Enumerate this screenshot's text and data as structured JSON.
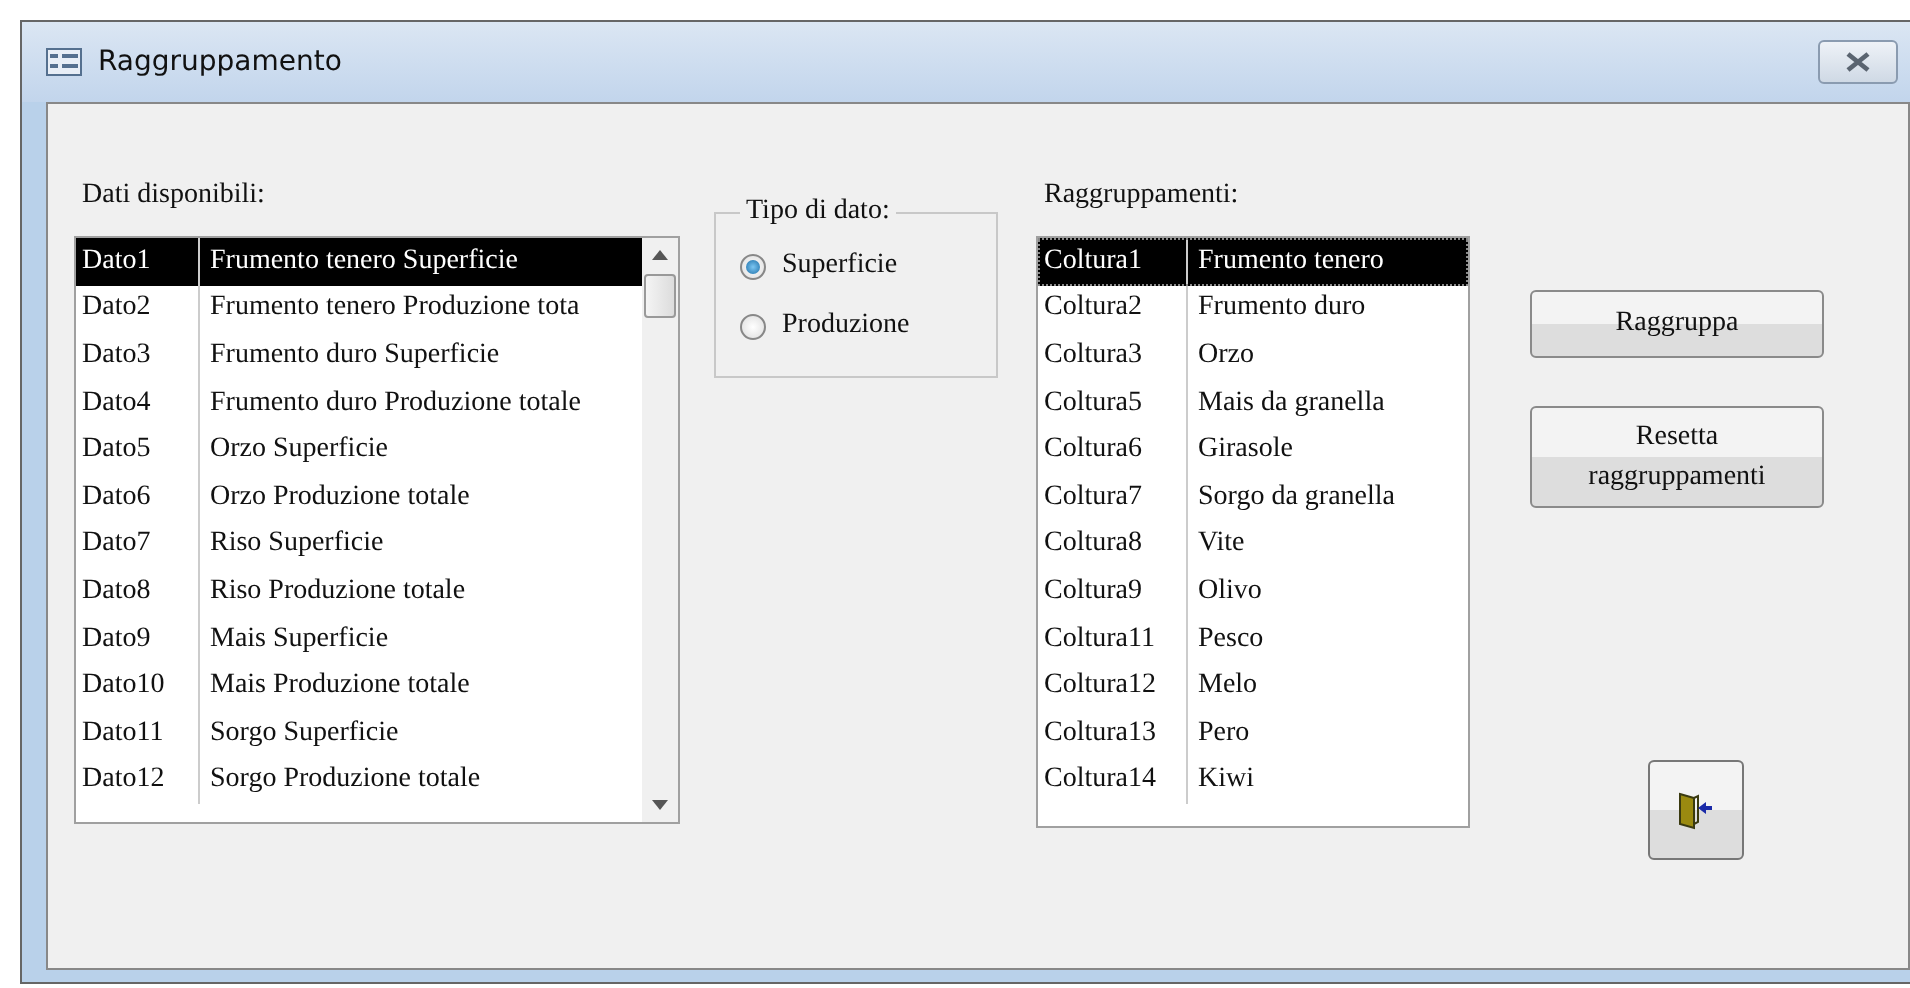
{
  "window": {
    "title": "Raggruppamento"
  },
  "available": {
    "label": "Dati disponibili:",
    "rows": [
      {
        "code": "Dato1",
        "name": "Frumento tenero Superficie",
        "selected": true
      },
      {
        "code": "Dato2",
        "name": "Frumento tenero Produzione tota",
        "selected": false
      },
      {
        "code": "Dato3",
        "name": "Frumento duro Superficie",
        "selected": false
      },
      {
        "code": "Dato4",
        "name": "Frumento duro Produzione totale",
        "selected": false
      },
      {
        "code": "Dato5",
        "name": "Orzo Superficie",
        "selected": false
      },
      {
        "code": "Dato6",
        "name": "Orzo Produzione totale",
        "selected": false
      },
      {
        "code": "Dato7",
        "name": "Riso Superficie",
        "selected": false
      },
      {
        "code": "Dato8",
        "name": "Riso Produzione totale",
        "selected": false
      },
      {
        "code": "Dato9",
        "name": "Mais Superficie",
        "selected": false
      },
      {
        "code": "Dato10",
        "name": "Mais Produzione totale",
        "selected": false
      },
      {
        "code": "Dato11",
        "name": "Sorgo Superficie",
        "selected": false
      },
      {
        "code": "Dato12",
        "name": "Sorgo Produzione totale",
        "selected": false
      }
    ]
  },
  "data_type": {
    "label": "Tipo di dato:",
    "options": [
      {
        "label": "Superficie",
        "selected": true
      },
      {
        "label": "Produzione",
        "selected": false
      }
    ]
  },
  "groups": {
    "label": "Raggruppamenti:",
    "rows": [
      {
        "code": "Coltura1",
        "name": "Frumento tenero",
        "selected": true
      },
      {
        "code": "Coltura2",
        "name": "Frumento duro",
        "selected": false
      },
      {
        "code": "Coltura3",
        "name": "Orzo",
        "selected": false
      },
      {
        "code": "Coltura5",
        "name": "Mais da granella",
        "selected": false
      },
      {
        "code": "Coltura6",
        "name": "Girasole",
        "selected": false
      },
      {
        "code": "Coltura7",
        "name": "Sorgo da granella",
        "selected": false
      },
      {
        "code": "Coltura8",
        "name": "Vite",
        "selected": false
      },
      {
        "code": "Coltura9",
        "name": "Olivo",
        "selected": false
      },
      {
        "code": "Coltura11",
        "name": "Pesco",
        "selected": false
      },
      {
        "code": "Coltura12",
        "name": "Melo",
        "selected": false
      },
      {
        "code": "Coltura13",
        "name": "Pero",
        "selected": false
      },
      {
        "code": "Coltura14",
        "name": "Kiwi",
        "selected": false
      }
    ]
  },
  "buttons": [
    {
      "label": "Raggruppa"
    },
    {
      "label": "Resetta raggruppamenti"
    }
  ]
}
